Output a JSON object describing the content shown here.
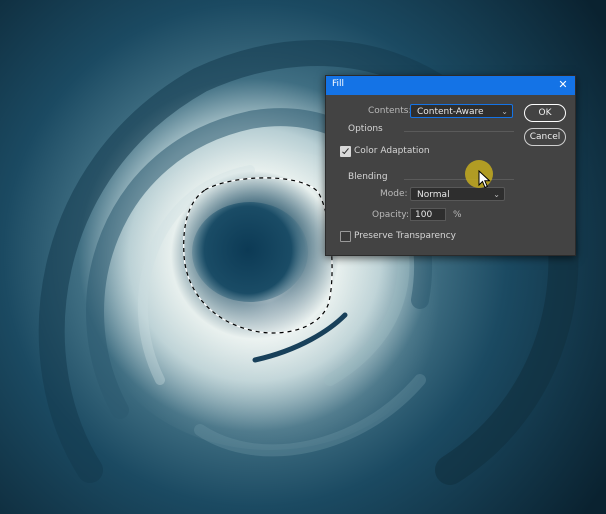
{
  "dialog": {
    "title": "Fill",
    "close_glyph": "✕",
    "contents_label": "Contents:",
    "contents_value": "Content-Aware",
    "ok_label": "OK",
    "cancel_label": "Cancel",
    "options_label": "Options",
    "color_adaptation_label": "Color Adaptation",
    "color_adaptation_checked": true,
    "blending_label": "Blending",
    "mode_label": "Mode:",
    "mode_value": "Normal",
    "opacity_label": "Opacity:",
    "opacity_value": "100",
    "opacity_unit": "%",
    "preserve_transparency_label": "Preserve Transparency",
    "preserve_transparency_checked": false
  },
  "colors": {
    "titlebar": "#1473e6",
    "dialog_bg": "#434343",
    "cursor_highlight": "#c4ac1e"
  },
  "icons": {
    "close": "close-icon",
    "dropdown": "chevron-down-icon",
    "checkmark": "check-icon",
    "cursor": "arrow-pointer-icon"
  }
}
